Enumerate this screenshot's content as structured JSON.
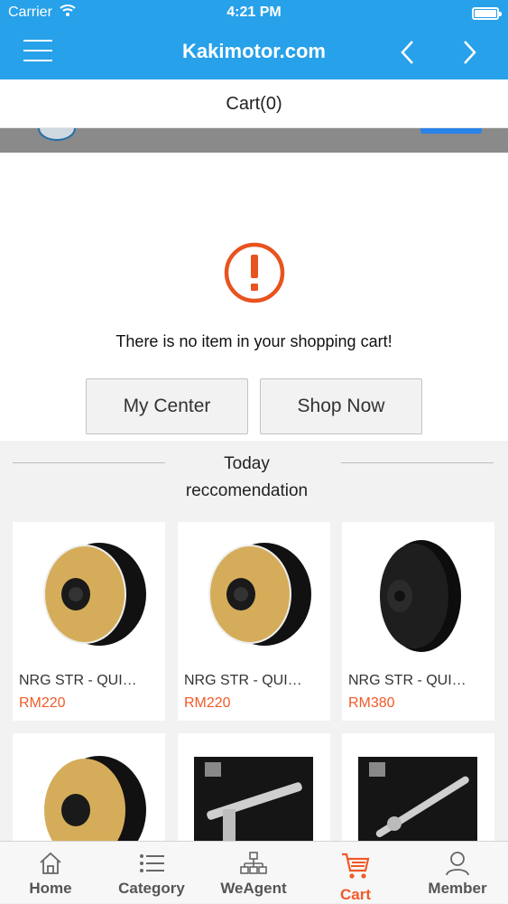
{
  "status_bar": {
    "carrier": "Carrier",
    "time": "4:21 PM"
  },
  "nav": {
    "title": "Kakimotor.com",
    "menu_icon": "hamburger-menu-icon",
    "back_icon": "chevron-left-icon",
    "forward_icon": "chevron-right-icon"
  },
  "subheader": {
    "title": "Cart(0)"
  },
  "empty_state": {
    "icon": "exclamation-circle-icon",
    "message": "There is no item in your shopping cart!",
    "my_center_label": "My Center",
    "shop_now_label": "Shop Now"
  },
  "recommendation": {
    "title_line1": "Today",
    "title_line2": "reccomendation",
    "products": [
      {
        "name": "NRG STR - QUI…",
        "price": "RM220"
      },
      {
        "name": "NRG STR - QUI…",
        "price": "RM220"
      },
      {
        "name": "NRG STR - QUI…",
        "price": "RM380"
      },
      {
        "name": "",
        "price": ""
      },
      {
        "name": "",
        "price": ""
      },
      {
        "name": "",
        "price": ""
      }
    ]
  },
  "colors": {
    "accent": "#27a1e9",
    "price": "#f05a28",
    "alert": "#e8531f"
  },
  "tabbar": {
    "home": "Home",
    "category": "Category",
    "weagent": "WeAgent",
    "cart": "Cart",
    "member": "Member"
  }
}
